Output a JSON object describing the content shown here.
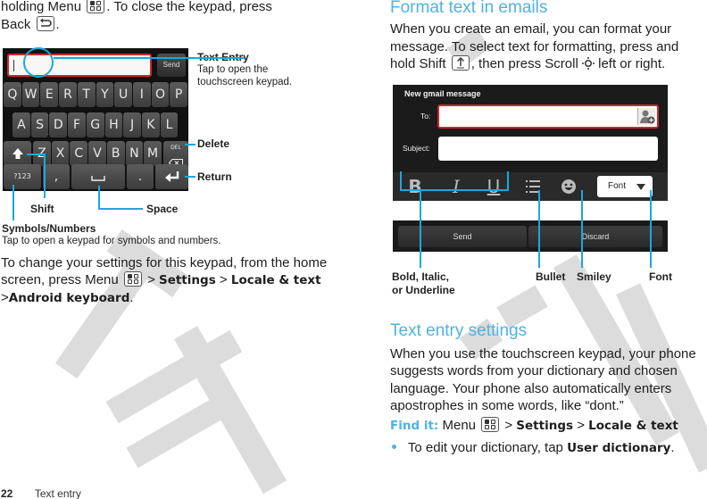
{
  "footer": {
    "page_number": "22",
    "section": "Text entry"
  },
  "left": {
    "intro": {
      "line1_pre": "holding Menu",
      "line1_post": ". To close the keypad, press",
      "line2_pre": "Back",
      "line2_post": "."
    },
    "keyboard": {
      "send_label": "Send",
      "rows": [
        [
          "Q",
          "W",
          "E",
          "R",
          "T",
          "Y",
          "U",
          "I",
          "O",
          "P"
        ],
        [
          "A",
          "S",
          "D",
          "F",
          "G",
          "H",
          "J",
          "K",
          "L"
        ],
        [
          "Z",
          "X",
          "C",
          "V",
          "B",
          "N",
          "M"
        ]
      ],
      "symbols_key": "?123",
      "comma_key": ",",
      "period_key": ".",
      "delete_key": "DEL"
    },
    "callouts": {
      "text_entry_title": "Text Entry",
      "text_entry_sub1": "Tap to open the",
      "text_entry_sub2": "touchscreen keypad.",
      "delete": "Delete",
      "return": "Return",
      "shift": "Shift",
      "space": "Space",
      "symbols_title": "Symbols/Numbers",
      "symbols_sub": "Tap to open a keypad for symbols and numbers."
    },
    "settings_para": {
      "line1": "To change your settings for this keypad, from the home",
      "line2_pre": "screen, press Menu",
      "sep": ">",
      "settings": "Settings",
      "locale": "Locale & text",
      "android_keyboard": "Android keyboard",
      "end": "."
    }
  },
  "right": {
    "format_heading": "Format text in emails",
    "format_para": {
      "line1": "When you create an email, you can format your",
      "line2": "message. To select text for formatting, press and",
      "line3_pre": "hold Shift",
      "line3_mid": ", then press Scroll",
      "line3_post": "left or right."
    },
    "email": {
      "title": "New gmail message",
      "to_label": "To:",
      "subject_label": "Subject:",
      "font_label": "Font",
      "send_label": "Send",
      "discard_label": "Discard"
    },
    "callouts": {
      "biu_line1": "Bold, Italic,",
      "biu_line2": "or Underline",
      "bullet": "Bullet",
      "smiley": "Smiley",
      "font": "Font"
    },
    "settings_heading": "Text entry settings",
    "settings_para": {
      "line1": "When you use the touchscreen keypad, your phone",
      "line2": "suggests words from your dictionary and chosen",
      "line3": "language. Your phone also automatically enters",
      "line4": "apostrophes in some words, like “dont.”"
    },
    "find_it": {
      "label": "Find it:",
      "menu": "Menu",
      "sep": ">",
      "settings": "Settings",
      "locale": "Locale & text"
    },
    "bullet_item": {
      "pre": "To edit your dictionary, tap",
      "bold": "User dictionary",
      "post": "."
    }
  },
  "watermark": "DRAFT",
  "colors": {
    "accent": "#4eb3e3",
    "callout_line": "#1aa8e0",
    "watermark": "#dcdcdc",
    "highlight_red": "#cc2a2a"
  }
}
